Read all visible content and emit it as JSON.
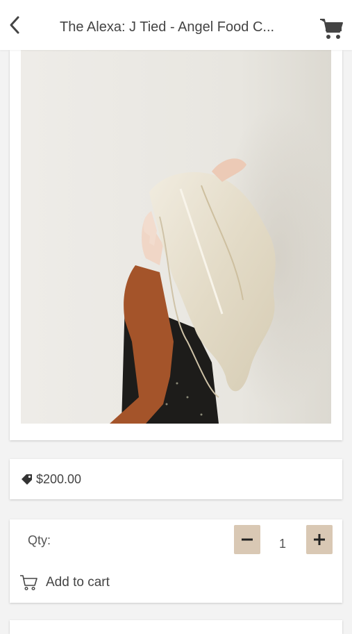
{
  "header": {
    "title": "The Alexa: J Tied - Angel Food C...",
    "back_icon": "chevron-left-icon",
    "cart_icon": "shopping-cart-icon"
  },
  "product": {
    "image_alt": "Woman with long blonde wavy hair extensions",
    "price": "$200.00",
    "price_icon": "tag-icon"
  },
  "purchase": {
    "qty_label": "Qty:",
    "qty_value": "1",
    "minus_label": "−",
    "plus_label": "+",
    "add_to_cart_label": "Add to cart",
    "add_to_cart_icon": "cart-outline-icon"
  },
  "colors": {
    "accent": "#d9c8b4",
    "background": "#f3f3f3",
    "card": "#ffffff"
  }
}
